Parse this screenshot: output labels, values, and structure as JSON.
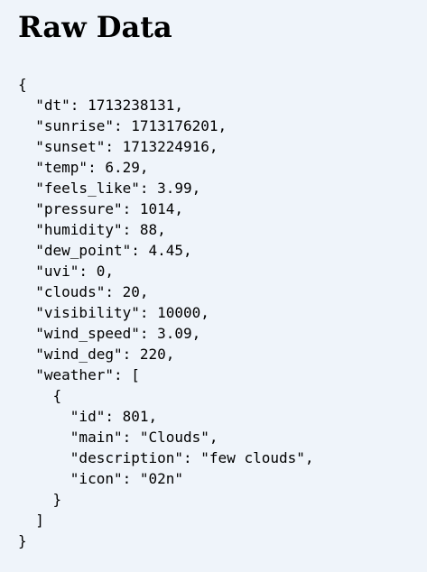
{
  "page": {
    "title": "Raw Data",
    "background": "#eff4fa"
  },
  "raw_json": {
    "lines": [
      "{",
      "  \"dt\": 1713238131,",
      "  \"sunrise\": 1713176201,",
      "  \"sunset\": 1713224916,",
      "  \"temp\": 6.29,",
      "  \"feels_like\": 3.99,",
      "  \"pressure\": 1014,",
      "  \"humidity\": 88,",
      "  \"dew_point\": 4.45,",
      "  \"uvi\": 0,",
      "  \"clouds\": 20,",
      "  \"visibility\": 10000,",
      "  \"wind_speed\": 3.09,",
      "  \"wind_deg\": 220,",
      "  \"weather\": [",
      "    {",
      "      \"id\": 801,",
      "      \"main\": \"Clouds\",",
      "      \"description\": \"few clouds\",",
      "      \"icon\": \"02n\"",
      "    }",
      "  ]",
      "}"
    ]
  }
}
